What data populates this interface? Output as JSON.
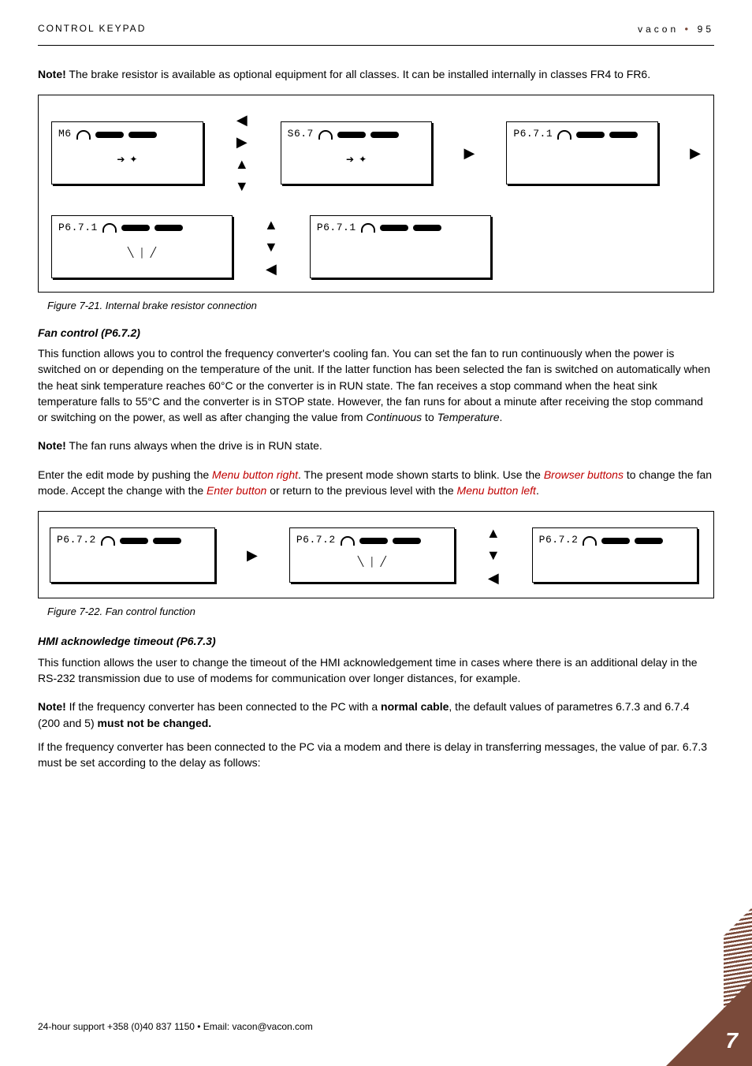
{
  "header": {
    "left": "CONTROL KEYPAD",
    "right_brand": "vacon",
    "right_page": "95"
  },
  "para1_prefix": "Note!",
  "para1_body": " The brake resistor is available as optional equipment for all classes. It can be installed internally in classes FR4 to FR6.",
  "fig1": {
    "row1": {
      "box1_label": "M6",
      "box2_label": "S6.7",
      "box3_label": "P6.7.1"
    },
    "row2": {
      "box1_label": "P6.7.1",
      "box2_label": "P6.7.1"
    }
  },
  "caption1": "Figure 7-21. Internal brake resistor connection",
  "heading1": "Fan control (P6.7.2)",
  "para2": "This function allows you to control the frequency converter's cooling fan. You can set the fan to run continuously when the power is switched on or depending on the temperature of the unit. If the latter function has been selected the fan is switched on automatically when the heat sink temperature reaches 60°C or the converter is in RUN state. The fan receives a stop command when the heat sink temperature falls to 55°C and the converter is in STOP state. However, the fan runs for about a minute after receiving the stop command or switching on the power, as well as after changing the value from ",
  "para2_it1": "Continuous",
  "para2_mid": " to ",
  "para2_it2": "Temperature",
  "para2_end": ".",
  "para3_prefix": "Note!",
  "para3_body": " The fan runs always when the drive is in RUN state.",
  "para4_a": "Enter the edit mode by pushing the ",
  "link1": "Menu button right",
  "para4_b": ". The present mode shown starts to blink. Use the ",
  "link2": "Browser buttons",
  "para4_c": " to change the fan mode. Accept the change with the ",
  "link3": "Enter button",
  "para4_d": " or return to the previous level with the ",
  "link4": "Menu button left",
  "para4_e": ".",
  "fig2": {
    "box1_label": "P6.7.2",
    "box2_label": "P6.7.2",
    "box3_label": "P6.7.2"
  },
  "caption2": "Figure 7-22. Fan control function",
  "heading2": "HMI acknowledge timeout (P6.7.3)",
  "para5": "This function allows the user to change the timeout of the HMI acknowledgement time in cases where there is an additional delay in the RS-232 transmission due to use of modems for communication over longer distances, for example.",
  "para6_prefix": "Note!",
  "para6_a": " If the frequency converter has been connected to the PC with a ",
  "para6_bold1": "normal cable",
  "para6_b": ", the default values of parametres 6.7.3 and 6.7.4 (200 and 5) ",
  "para6_bold2": "must not be changed.",
  "para7": "If the frequency converter has been connected to the PC via a modem and there is delay in transferring messages, the value of par. 6.7.3 must be set according to the delay as follows:",
  "footer_text": "24-hour support +358 (0)40 837 1150 • Email: vacon@vacon.com",
  "page_number": "7"
}
